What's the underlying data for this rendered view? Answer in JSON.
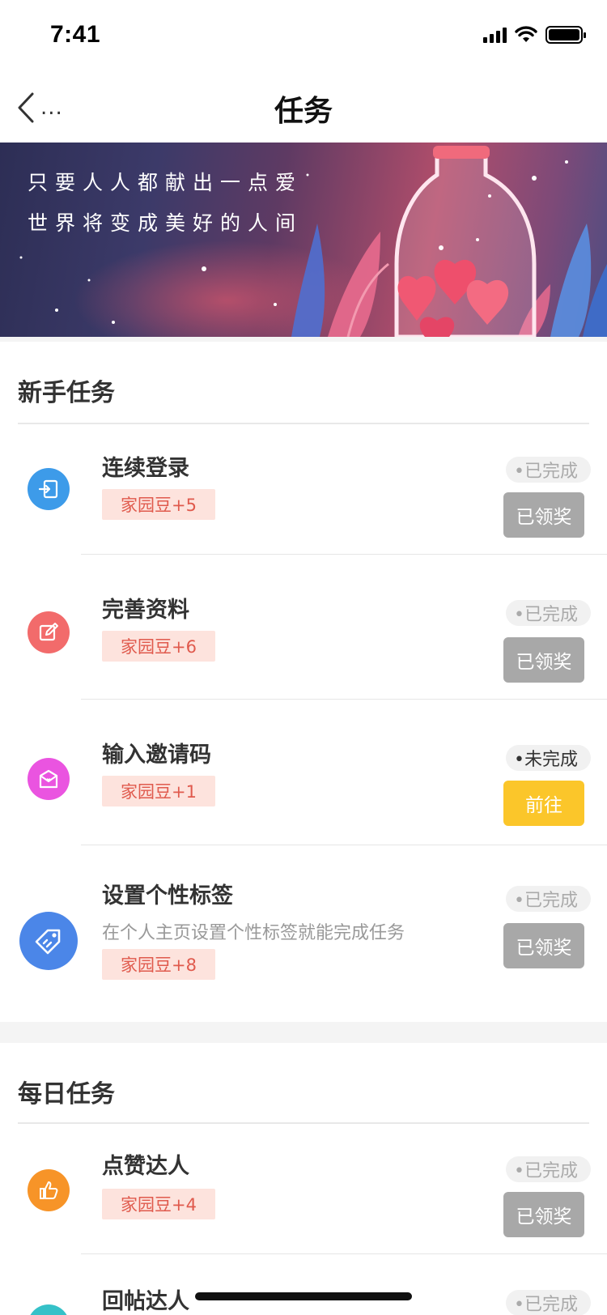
{
  "status_bar": {
    "time": "7:41"
  },
  "nav": {
    "title": "任务",
    "more": "..."
  },
  "banner": {
    "line1": "只要人人都献出一点爱",
    "line2": "世界将变成美好的人间"
  },
  "newbie": {
    "title": "新手任务",
    "tasks": [
      {
        "name": "连续登录",
        "reward": "家园豆+5",
        "status": "•已完成",
        "action": "已领奖",
        "icon": "login-icon",
        "color": "#3d9be9"
      },
      {
        "name": "完善资料",
        "reward": "家园豆+6",
        "status": "•已完成",
        "action": "已领奖",
        "icon": "edit-icon",
        "color": "#f26b6b"
      },
      {
        "name": "输入邀请码",
        "reward": "家园豆+1",
        "status": "•未完成",
        "action": "前往",
        "icon": "invite-mail-icon",
        "color": "#ea54e0"
      },
      {
        "name": "设置个性标签",
        "desc": "在个人主页设置个性标签就能完成任务",
        "reward": "家园豆+8",
        "status": "•已完成",
        "action": "已领奖",
        "icon": "tag-icon",
        "color": "#4b86e8"
      }
    ]
  },
  "daily": {
    "title": "每日任务",
    "tasks": [
      {
        "name": "点赞达人",
        "reward": "家园豆+4",
        "status": "•已完成",
        "action": "已领奖",
        "icon": "thumbs-up-icon",
        "color": "#f79428"
      },
      {
        "name": "回帖达人",
        "status": "•已完成",
        "icon": "reply-icon",
        "color": "#35c1c8"
      }
    ]
  }
}
